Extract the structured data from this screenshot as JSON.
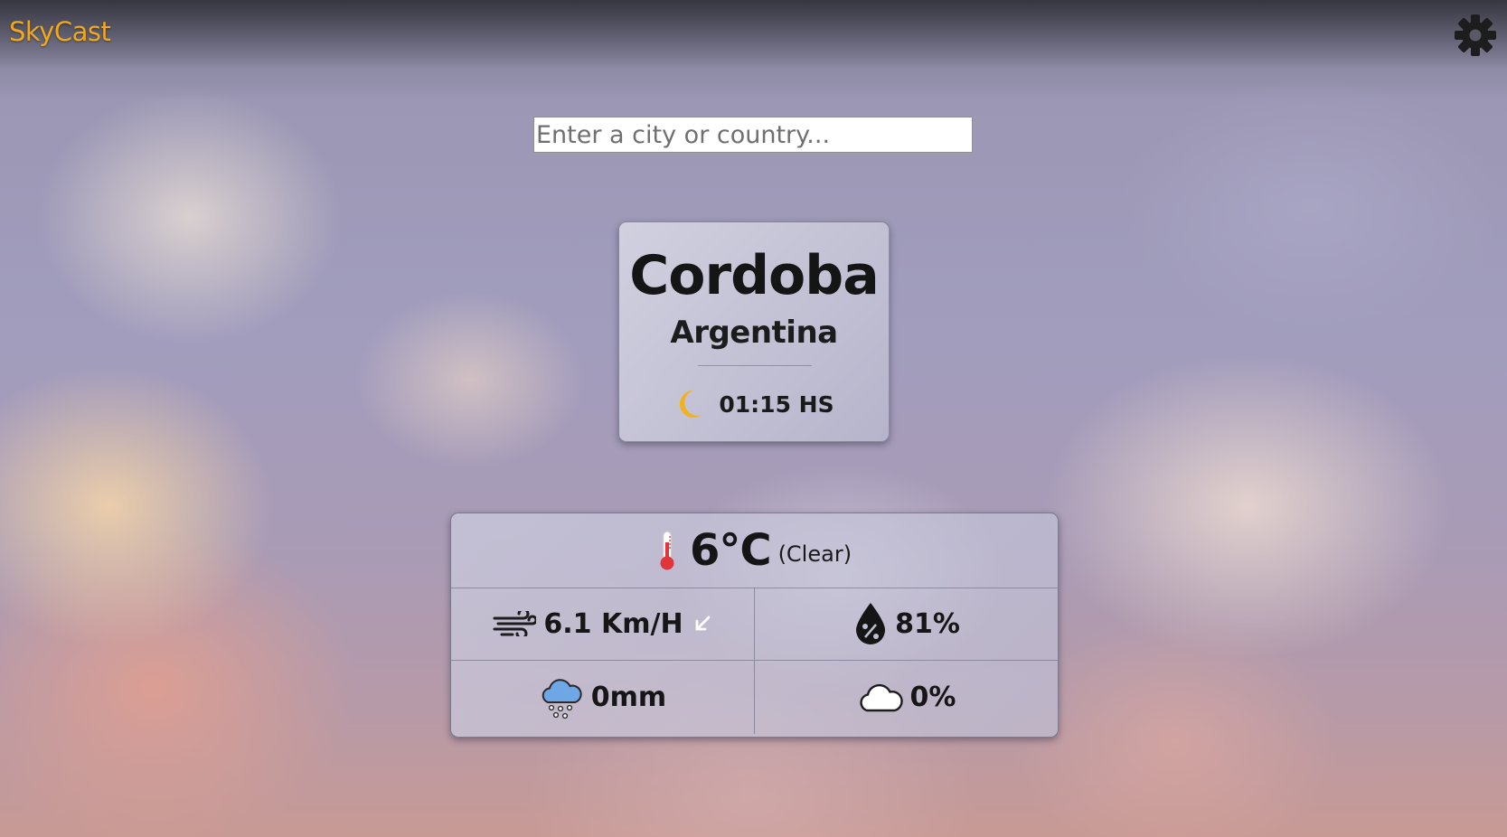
{
  "app": {
    "brand": "SkyCast"
  },
  "header": {
    "settings_icon": "gear-icon"
  },
  "search": {
    "placeholder": "Enter a city or country...",
    "value": ""
  },
  "location": {
    "city": "Cordoba",
    "country": "Argentina",
    "time_icon": "moon-icon",
    "time": "01:15 HS"
  },
  "weather": {
    "temperature_icon": "thermometer-icon",
    "temperature": "6°C",
    "condition": "(Clear)",
    "wind_icon": "wind-icon",
    "wind": "6.1 Km/H",
    "wind_direction_icon": "arrow-down-left-icon",
    "humidity_icon": "humidity-drop-icon",
    "humidity": "81%",
    "precipitation_icon": "rain-cloud-icon",
    "precipitation": "0mm",
    "cloud_icon": "cloud-icon",
    "cloud_cover": "0%"
  },
  "colors": {
    "brand": "#f0a81c",
    "moon": "#f2b21e",
    "thermometer": "#e0353a",
    "rain_cloud": "#6fa7e6"
  }
}
